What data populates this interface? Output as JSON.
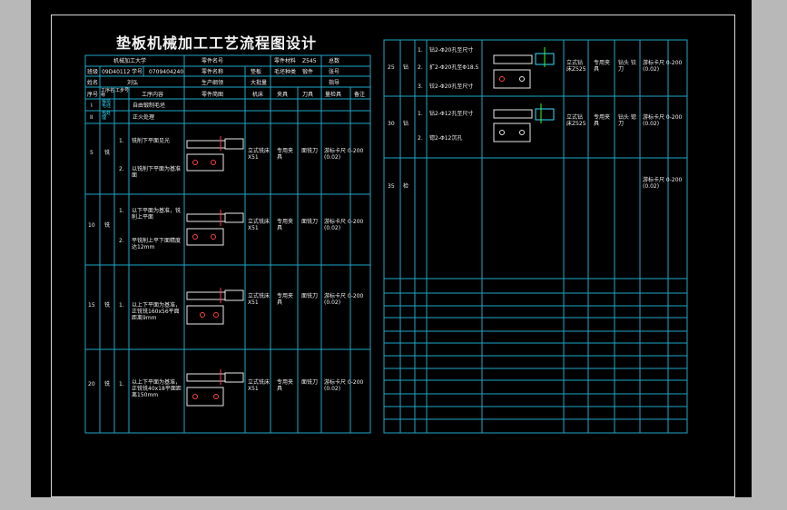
{
  "title": "垫板机械加工工艺流程图设计",
  "header": {
    "school": "机械加工大学",
    "part_no_label": "零件名号",
    "material_label": "零件材料",
    "material_value": "Z545",
    "total_label": "总数",
    "class_label": "班级",
    "class_value": "09D40112",
    "student_no_label": "学号",
    "student_no_value": "0709404240",
    "part_name_label": "零件名称",
    "part_name_value": "垫板",
    "hardness_label": "毛坯种类",
    "hardness_value": "锻件",
    "page_label": "张号",
    "name_label": "姓名",
    "name_value": "刘弘",
    "production_label": "生产纲领",
    "production_value": "大批量",
    "guide_label": "指导"
  },
  "columns": [
    "序号",
    "工序名称",
    "工步号",
    "工序内容",
    "零件简图",
    "机床",
    "夹具",
    "刀具",
    "量检具",
    "备注"
  ],
  "left_rows": [
    {
      "no": "I",
      "name": "锻造毛坯",
      "content": "自由锻制毛坯"
    },
    {
      "no": "II",
      "name": "热处理",
      "content": "正火处理"
    },
    {
      "no": "5",
      "name": "铣",
      "step1": "1.",
      "content1": "铣削下平面见光",
      "step2": "2.",
      "content2": "以铣削下平面为基准面",
      "machine": "立式铣床X51",
      "fixture": "专用夹具",
      "tool": "面铣刀",
      "gauge": "游标卡尺 0-200 (0.02)"
    },
    {
      "no": "10",
      "name": "铣",
      "step1": "1.",
      "content1": "以下平面为基准，铣削上平面",
      "step2": "2.",
      "content2": "平铣削上平下面精度达12mm",
      "machine": "立式铣床X51",
      "fixture": "专用夹具",
      "tool": "面铣刀",
      "gauge": "游标卡尺 0-200 (0.02)"
    },
    {
      "no": "15",
      "name": "铣",
      "step1": "1.",
      "content1": "以上下平面为基准，正铣铣160x56平面距离9mm",
      "machine": "立式铣床X51",
      "fixture": "专用夹具",
      "tool": "面铣刀",
      "gauge": "游标卡尺 0-200 (0.02)"
    },
    {
      "no": "20",
      "name": "铣",
      "step1": "1.",
      "content1": "以上下平面为基准，正铣铣40x18平面距离150mm",
      "machine": "立式铣床X51",
      "fixture": "专用夹具",
      "tool": "面铣刀",
      "gauge": "游标卡尺 0-200 (0.02)"
    }
  ],
  "right_rows": [
    {
      "no": "25",
      "name": "钻",
      "s1": "1.",
      "c1": "钻2-Φ20孔至尺寸",
      "s2": "2.",
      "c2": "扩2-Φ20孔至Φ18.5",
      "s3": "3.",
      "c3": "铰2-Φ20孔至尺寸",
      "machine": "立式钻床Z525",
      "fixture": "专用夹具",
      "tool": "钻头 铰刀",
      "gauge": "游标卡尺 0-200 (0.02)"
    },
    {
      "no": "30",
      "name": "钻",
      "s1": "1.",
      "c1": "钻2-Φ12孔至尺寸",
      "s2": "2.",
      "c2": "锪2-Φ12沉孔",
      "machine": "立式钻床Z525",
      "fixture": "专用夹具",
      "tool": "钻头 锪刀",
      "gauge": "游标卡尺 0-200 (0.02)"
    },
    {
      "no": "35",
      "name": "检",
      "gauge": "游标卡尺 0-200 (0.02)"
    }
  ]
}
